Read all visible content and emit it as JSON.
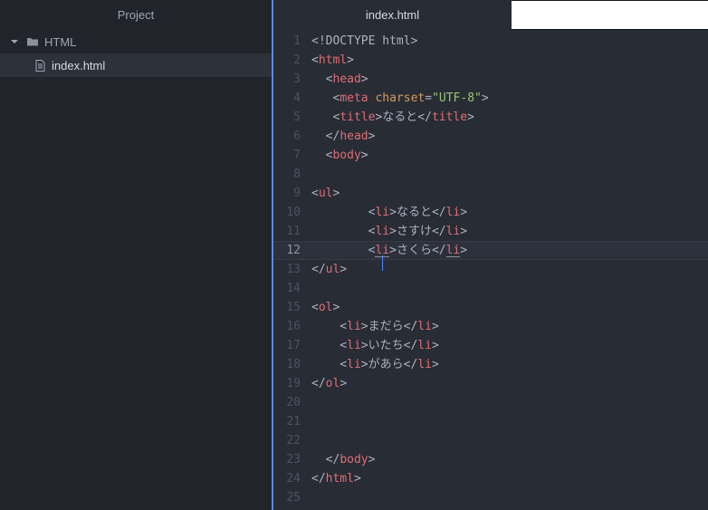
{
  "sidebar": {
    "header": "Project",
    "items": [
      {
        "type": "folder",
        "label": "HTML",
        "expanded": true
      },
      {
        "type": "file",
        "label": "index.html",
        "selected": true
      }
    ]
  },
  "tabs": [
    {
      "label": "index.html",
      "active": true
    }
  ],
  "editor": {
    "active_line": 12,
    "total_lines": 25,
    "lines": [
      {
        "n": 1,
        "s": [
          {
            "t": "<!DOCTYPE html>",
            "c": "plain"
          }
        ]
      },
      {
        "n": 2,
        "s": [
          {
            "t": "<",
            "c": "plain"
          },
          {
            "t": "html",
            "c": "tag"
          },
          {
            "t": ">",
            "c": "plain"
          }
        ]
      },
      {
        "n": 3,
        "s": [
          {
            "t": "  <",
            "c": "plain"
          },
          {
            "t": "head",
            "c": "tag"
          },
          {
            "t": ">",
            "c": "plain"
          }
        ]
      },
      {
        "n": 4,
        "s": [
          {
            "t": "   <",
            "c": "plain"
          },
          {
            "t": "meta",
            "c": "tag"
          },
          {
            "t": " ",
            "c": "plain"
          },
          {
            "t": "charset",
            "c": "attr"
          },
          {
            "t": "=",
            "c": "plain"
          },
          {
            "t": "\"UTF-8\"",
            "c": "str"
          },
          {
            "t": ">",
            "c": "plain"
          }
        ]
      },
      {
        "n": 5,
        "s": [
          {
            "t": "   <",
            "c": "plain"
          },
          {
            "t": "title",
            "c": "tag"
          },
          {
            "t": ">",
            "c": "plain"
          },
          {
            "t": "なると",
            "c": "plain"
          },
          {
            "t": "</",
            "c": "plain"
          },
          {
            "t": "title",
            "c": "tag"
          },
          {
            "t": ">",
            "c": "plain"
          }
        ]
      },
      {
        "n": 6,
        "s": [
          {
            "t": "  </",
            "c": "plain"
          },
          {
            "t": "head",
            "c": "tag"
          },
          {
            "t": ">",
            "c": "plain"
          }
        ]
      },
      {
        "n": 7,
        "s": [
          {
            "t": "  <",
            "c": "plain"
          },
          {
            "t": "body",
            "c": "tag"
          },
          {
            "t": ">",
            "c": "plain"
          }
        ]
      },
      {
        "n": 8,
        "s": []
      },
      {
        "n": 9,
        "s": [
          {
            "t": "<",
            "c": "plain"
          },
          {
            "t": "ul",
            "c": "tag"
          },
          {
            "t": ">",
            "c": "plain"
          }
        ]
      },
      {
        "n": 10,
        "s": [
          {
            "t": "        <",
            "c": "plain"
          },
          {
            "t": "li",
            "c": "tag"
          },
          {
            "t": ">",
            "c": "plain"
          },
          {
            "t": "なると",
            "c": "plain"
          },
          {
            "t": "</",
            "c": "plain"
          },
          {
            "t": "li",
            "c": "tag"
          },
          {
            "t": ">",
            "c": "plain"
          }
        ]
      },
      {
        "n": 11,
        "s": [
          {
            "t": "        <",
            "c": "plain"
          },
          {
            "t": "li",
            "c": "tag"
          },
          {
            "t": ">",
            "c": "plain"
          },
          {
            "t": "さすけ",
            "c": "plain"
          },
          {
            "t": "</",
            "c": "plain"
          },
          {
            "t": "li",
            "c": "tag"
          },
          {
            "t": ">",
            "c": "plain"
          }
        ]
      },
      {
        "n": 12,
        "s": [
          {
            "t": "        <",
            "c": "plain"
          },
          {
            "t": "l",
            "c": "tag",
            "u": true
          },
          {
            "cursor": true
          },
          {
            "t": "i",
            "c": "tag",
            "u": true
          },
          {
            "t": ">",
            "c": "plain"
          },
          {
            "t": "さくら",
            "c": "plain"
          },
          {
            "t": "</",
            "c": "plain"
          },
          {
            "t": "li",
            "c": "tag",
            "u": true
          },
          {
            "t": ">",
            "c": "plain"
          }
        ]
      },
      {
        "n": 13,
        "s": [
          {
            "t": "</",
            "c": "plain"
          },
          {
            "t": "ul",
            "c": "tag"
          },
          {
            "t": ">",
            "c": "plain"
          }
        ]
      },
      {
        "n": 14,
        "s": []
      },
      {
        "n": 15,
        "s": [
          {
            "t": "<",
            "c": "plain"
          },
          {
            "t": "ol",
            "c": "tag"
          },
          {
            "t": ">",
            "c": "plain"
          }
        ]
      },
      {
        "n": 16,
        "s": [
          {
            "t": "    <",
            "c": "plain"
          },
          {
            "t": "li",
            "c": "tag"
          },
          {
            "t": ">",
            "c": "plain"
          },
          {
            "t": "まだら",
            "c": "plain"
          },
          {
            "t": "</",
            "c": "plain"
          },
          {
            "t": "li",
            "c": "tag"
          },
          {
            "t": ">",
            "c": "plain"
          }
        ]
      },
      {
        "n": 17,
        "s": [
          {
            "t": "    <",
            "c": "plain"
          },
          {
            "t": "li",
            "c": "tag"
          },
          {
            "t": ">",
            "c": "plain"
          },
          {
            "t": "いたち",
            "c": "plain"
          },
          {
            "t": "</",
            "c": "plain"
          },
          {
            "t": "li",
            "c": "tag"
          },
          {
            "t": ">",
            "c": "plain"
          }
        ]
      },
      {
        "n": 18,
        "s": [
          {
            "t": "    <",
            "c": "plain"
          },
          {
            "t": "li",
            "c": "tag"
          },
          {
            "t": ">",
            "c": "plain"
          },
          {
            "t": "があら",
            "c": "plain"
          },
          {
            "t": "</",
            "c": "plain"
          },
          {
            "t": "li",
            "c": "tag"
          },
          {
            "t": ">",
            "c": "plain"
          }
        ]
      },
      {
        "n": 19,
        "s": [
          {
            "t": "</",
            "c": "plain"
          },
          {
            "t": "ol",
            "c": "tag"
          },
          {
            "t": ">",
            "c": "plain"
          }
        ]
      },
      {
        "n": 20,
        "s": []
      },
      {
        "n": 21,
        "s": []
      },
      {
        "n": 22,
        "s": []
      },
      {
        "n": 23,
        "s": [
          {
            "t": "  </",
            "c": "plain"
          },
          {
            "t": "body",
            "c": "tag"
          },
          {
            "t": ">",
            "c": "plain"
          }
        ]
      },
      {
        "n": 24,
        "s": [
          {
            "t": "</",
            "c": "plain"
          },
          {
            "t": "html",
            "c": "tag"
          },
          {
            "t": ">",
            "c": "plain"
          }
        ]
      },
      {
        "n": 25,
        "s": []
      }
    ]
  },
  "colors": {
    "editor_bg": "#282c34",
    "panel_bg": "#21252b",
    "accent": "#568af2",
    "tag": "#e06c75",
    "attr": "#d19a66",
    "string": "#98c379",
    "text": "#abb2bf",
    "line_number": "#4b5263",
    "selection_bg": "#2c313a"
  }
}
